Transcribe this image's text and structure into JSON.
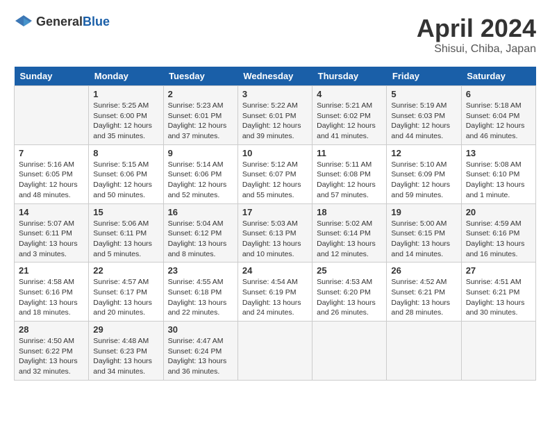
{
  "header": {
    "logo_general": "General",
    "logo_blue": "Blue",
    "month": "April 2024",
    "location": "Shisui, Chiba, Japan"
  },
  "weekdays": [
    "Sunday",
    "Monday",
    "Tuesday",
    "Wednesday",
    "Thursday",
    "Friday",
    "Saturday"
  ],
  "weeks": [
    [
      {
        "day": "",
        "info": ""
      },
      {
        "day": "1",
        "info": "Sunrise: 5:25 AM\nSunset: 6:00 PM\nDaylight: 12 hours\nand 35 minutes."
      },
      {
        "day": "2",
        "info": "Sunrise: 5:23 AM\nSunset: 6:01 PM\nDaylight: 12 hours\nand 37 minutes."
      },
      {
        "day": "3",
        "info": "Sunrise: 5:22 AM\nSunset: 6:01 PM\nDaylight: 12 hours\nand 39 minutes."
      },
      {
        "day": "4",
        "info": "Sunrise: 5:21 AM\nSunset: 6:02 PM\nDaylight: 12 hours\nand 41 minutes."
      },
      {
        "day": "5",
        "info": "Sunrise: 5:19 AM\nSunset: 6:03 PM\nDaylight: 12 hours\nand 44 minutes."
      },
      {
        "day": "6",
        "info": "Sunrise: 5:18 AM\nSunset: 6:04 PM\nDaylight: 12 hours\nand 46 minutes."
      }
    ],
    [
      {
        "day": "7",
        "info": "Sunrise: 5:16 AM\nSunset: 6:05 PM\nDaylight: 12 hours\nand 48 minutes."
      },
      {
        "day": "8",
        "info": "Sunrise: 5:15 AM\nSunset: 6:06 PM\nDaylight: 12 hours\nand 50 minutes."
      },
      {
        "day": "9",
        "info": "Sunrise: 5:14 AM\nSunset: 6:06 PM\nDaylight: 12 hours\nand 52 minutes."
      },
      {
        "day": "10",
        "info": "Sunrise: 5:12 AM\nSunset: 6:07 PM\nDaylight: 12 hours\nand 55 minutes."
      },
      {
        "day": "11",
        "info": "Sunrise: 5:11 AM\nSunset: 6:08 PM\nDaylight: 12 hours\nand 57 minutes."
      },
      {
        "day": "12",
        "info": "Sunrise: 5:10 AM\nSunset: 6:09 PM\nDaylight: 12 hours\nand 59 minutes."
      },
      {
        "day": "13",
        "info": "Sunrise: 5:08 AM\nSunset: 6:10 PM\nDaylight: 13 hours\nand 1 minute."
      }
    ],
    [
      {
        "day": "14",
        "info": "Sunrise: 5:07 AM\nSunset: 6:11 PM\nDaylight: 13 hours\nand 3 minutes."
      },
      {
        "day": "15",
        "info": "Sunrise: 5:06 AM\nSunset: 6:11 PM\nDaylight: 13 hours\nand 5 minutes."
      },
      {
        "day": "16",
        "info": "Sunrise: 5:04 AM\nSunset: 6:12 PM\nDaylight: 13 hours\nand 8 minutes."
      },
      {
        "day": "17",
        "info": "Sunrise: 5:03 AM\nSunset: 6:13 PM\nDaylight: 13 hours\nand 10 minutes."
      },
      {
        "day": "18",
        "info": "Sunrise: 5:02 AM\nSunset: 6:14 PM\nDaylight: 13 hours\nand 12 minutes."
      },
      {
        "day": "19",
        "info": "Sunrise: 5:00 AM\nSunset: 6:15 PM\nDaylight: 13 hours\nand 14 minutes."
      },
      {
        "day": "20",
        "info": "Sunrise: 4:59 AM\nSunset: 6:16 PM\nDaylight: 13 hours\nand 16 minutes."
      }
    ],
    [
      {
        "day": "21",
        "info": "Sunrise: 4:58 AM\nSunset: 6:16 PM\nDaylight: 13 hours\nand 18 minutes."
      },
      {
        "day": "22",
        "info": "Sunrise: 4:57 AM\nSunset: 6:17 PM\nDaylight: 13 hours\nand 20 minutes."
      },
      {
        "day": "23",
        "info": "Sunrise: 4:55 AM\nSunset: 6:18 PM\nDaylight: 13 hours\nand 22 minutes."
      },
      {
        "day": "24",
        "info": "Sunrise: 4:54 AM\nSunset: 6:19 PM\nDaylight: 13 hours\nand 24 minutes."
      },
      {
        "day": "25",
        "info": "Sunrise: 4:53 AM\nSunset: 6:20 PM\nDaylight: 13 hours\nand 26 minutes."
      },
      {
        "day": "26",
        "info": "Sunrise: 4:52 AM\nSunset: 6:21 PM\nDaylight: 13 hours\nand 28 minutes."
      },
      {
        "day": "27",
        "info": "Sunrise: 4:51 AM\nSunset: 6:21 PM\nDaylight: 13 hours\nand 30 minutes."
      }
    ],
    [
      {
        "day": "28",
        "info": "Sunrise: 4:50 AM\nSunset: 6:22 PM\nDaylight: 13 hours\nand 32 minutes."
      },
      {
        "day": "29",
        "info": "Sunrise: 4:48 AM\nSunset: 6:23 PM\nDaylight: 13 hours\nand 34 minutes."
      },
      {
        "day": "30",
        "info": "Sunrise: 4:47 AM\nSunset: 6:24 PM\nDaylight: 13 hours\nand 36 minutes."
      },
      {
        "day": "",
        "info": ""
      },
      {
        "day": "",
        "info": ""
      },
      {
        "day": "",
        "info": ""
      },
      {
        "day": "",
        "info": ""
      }
    ]
  ]
}
